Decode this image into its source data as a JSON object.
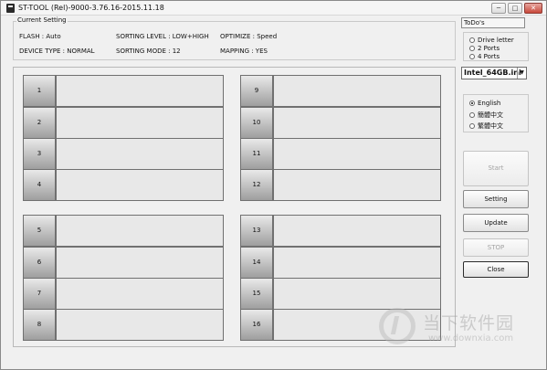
{
  "window": {
    "title": "ST-TOOL (Rel)-9000-3.76.16-2015.11.18",
    "controls": {
      "minimize": "─",
      "maximize": "□",
      "close": "✕"
    }
  },
  "current_setting": {
    "label": "Current Setting",
    "flash": "FLASH : Auto",
    "sorting_level": "SORTING LEVEL : LOW+HIGH",
    "optimize": "OPTIMIZE : Speed",
    "device_type": "DEVICE TYPE : NORMAL",
    "sorting_mode": "SORTING MODE : 12",
    "mapping": "MAPPING : YES"
  },
  "slots": [
    "1",
    "2",
    "3",
    "4",
    "5",
    "6",
    "7",
    "8",
    "9",
    "10",
    "11",
    "12",
    "13",
    "14",
    "15",
    "16"
  ],
  "todo": "ToDo's",
  "port_options": {
    "items": [
      "Drive letter",
      "2 Ports",
      "4 Ports"
    ],
    "selected": null
  },
  "ini_file": "Intel_64GB.ini",
  "language_options": {
    "items": [
      "English",
      "簡體中文",
      "繁體中文"
    ],
    "selected": 0
  },
  "buttons": {
    "start": "Start",
    "setting": "Setting",
    "update": "Update",
    "stop": "STOP",
    "close": "Close"
  },
  "watermark": {
    "name": "当下软件园",
    "url": "www.downxia.com"
  }
}
